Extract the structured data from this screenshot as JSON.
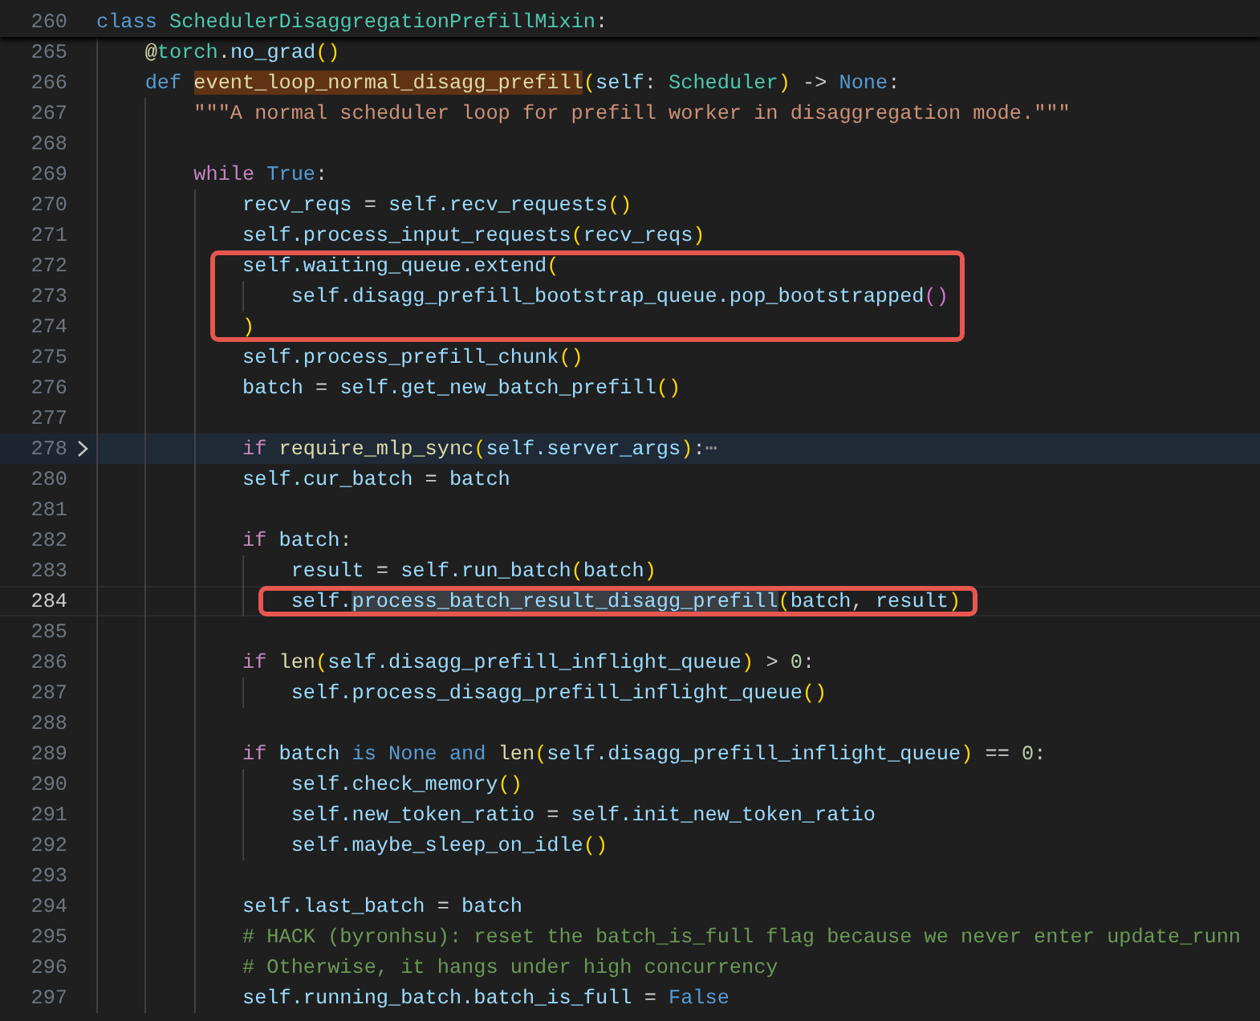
{
  "sticky_line": {
    "number": "260",
    "tokens": [
      {
        "kind": "kw",
        "text": "class "
      },
      {
        "kind": "type",
        "text": "SchedulerDisaggregationPrefillMixin"
      },
      {
        "kind": "op",
        "text": ":"
      }
    ]
  },
  "lines": [
    {
      "number": "265",
      "current": false,
      "folded": false,
      "boxed": false,
      "tokens": [
        {
          "kind": "deco",
          "text": "@"
        },
        {
          "kind": "type",
          "text": "torch"
        },
        {
          "kind": "op",
          "text": "."
        },
        {
          "kind": "var",
          "text": "no_grad"
        },
        {
          "kind": "paren",
          "text": "()"
        }
      ]
    },
    {
      "number": "266",
      "current": false,
      "folded": false,
      "boxed": false,
      "tokens": [
        {
          "kind": "kw",
          "text": "def "
        },
        {
          "kind": "fn",
          "text": "event_loop_normal_disagg_prefill",
          "highlighted": true
        },
        {
          "kind": "paren",
          "text": "("
        },
        {
          "kind": "var",
          "text": "self"
        },
        {
          "kind": "op",
          "text": ": "
        },
        {
          "kind": "type",
          "text": "Scheduler"
        },
        {
          "kind": "paren",
          "text": ")"
        },
        {
          "kind": "op",
          "text": " -> "
        },
        {
          "kind": "kw",
          "text": "None"
        },
        {
          "kind": "op",
          "text": ":"
        }
      ],
      "children": [
        {
          "number": "267",
          "current": false,
          "folded": false,
          "boxed": false,
          "tokens": [
            {
              "kind": "str",
              "text": "\"\"\"A normal scheduler loop for prefill worker in disaggregation mode.\"\"\""
            }
          ]
        },
        {
          "number": "268",
          "current": false,
          "folded": false,
          "boxed": false
        },
        {
          "number": "269",
          "current": false,
          "folded": false,
          "boxed": false,
          "tokens": [
            {
              "kind": "ctrl",
              "text": "while "
            },
            {
              "kind": "kw",
              "text": "True"
            },
            {
              "kind": "op",
              "text": ":"
            }
          ],
          "children": [
            {
              "number": "270",
              "current": false,
              "folded": false,
              "boxed": false,
              "tokens": [
                {
                  "kind": "var",
                  "text": "recv_reqs"
                },
                {
                  "kind": "op",
                  "text": " = "
                },
                {
                  "kind": "var",
                  "text": "self.recv_requests"
                },
                {
                  "kind": "paren",
                  "text": "()"
                }
              ]
            },
            {
              "number": "271",
              "current": false,
              "folded": false,
              "boxed": false,
              "tokens": [
                {
                  "kind": "var",
                  "text": "self.process_input_requests"
                },
                {
                  "kind": "paren",
                  "text": "("
                },
                {
                  "kind": "var",
                  "text": "recv_reqs"
                },
                {
                  "kind": "paren",
                  "text": ")"
                }
              ]
            },
            {
              "number": "272",
              "current": false,
              "folded": false,
              "boxed": true,
              "tokens": [
                {
                  "kind": "var",
                  "text": "self.waiting_queue.extend"
                },
                {
                  "kind": "paren",
                  "text": "("
                }
              ],
              "children": [
                {
                  "number": "273",
                  "current": false,
                  "folded": false,
                  "boxed": true,
                  "tokens": [
                    {
                      "kind": "var",
                      "text": "self.disagg_prefill_bootstrap_queue.pop_bootstrapped"
                    },
                    {
                      "kind": "paren2",
                      "text": "()"
                    }
                  ]
                }
              ]
            },
            {
              "number": "274",
              "current": false,
              "folded": false,
              "boxed": true,
              "tokens": [
                {
                  "kind": "paren",
                  "text": ")"
                }
              ]
            },
            {
              "number": "275",
              "current": false,
              "folded": false,
              "boxed": false,
              "tokens": [
                {
                  "kind": "var",
                  "text": "self.process_prefill_chunk"
                },
                {
                  "kind": "paren",
                  "text": "()"
                }
              ]
            },
            {
              "number": "276",
              "current": false,
              "folded": false,
              "boxed": false,
              "tokens": [
                {
                  "kind": "var",
                  "text": "batch"
                },
                {
                  "kind": "op",
                  "text": " = "
                },
                {
                  "kind": "var",
                  "text": "self.get_new_batch_prefill"
                },
                {
                  "kind": "paren",
                  "text": "()"
                }
              ]
            },
            {
              "number": "277",
              "current": false,
              "folded": false,
              "boxed": false
            },
            {
              "number": "278",
              "current": false,
              "folded": true,
              "boxed": false,
              "tokens": [
                {
                  "kind": "ctrl",
                  "text": "if "
                },
                {
                  "kind": "fn",
                  "text": "require_mlp_sync"
                },
                {
                  "kind": "paren",
                  "text": "("
                },
                {
                  "kind": "var",
                  "text": "self.server_args"
                },
                {
                  "kind": "paren",
                  "text": ")"
                },
                {
                  "kind": "op",
                  "text": ":"
                },
                {
                  "kind": "fold",
                  "text": "⋯"
                }
              ]
            },
            {
              "number": "280",
              "current": false,
              "folded": false,
              "boxed": false,
              "tokens": [
                {
                  "kind": "var",
                  "text": "self.cur_batch"
                },
                {
                  "kind": "op",
                  "text": " = "
                },
                {
                  "kind": "var",
                  "text": "batch"
                }
              ]
            },
            {
              "number": "281",
              "current": false,
              "folded": false,
              "boxed": false
            },
            {
              "number": "282",
              "current": false,
              "folded": false,
              "boxed": false,
              "tokens": [
                {
                  "kind": "ctrl",
                  "text": "if "
                },
                {
                  "kind": "var",
                  "text": "batch"
                },
                {
                  "kind": "op",
                  "text": ":"
                }
              ],
              "children": [
                {
                  "number": "283",
                  "current": false,
                  "folded": false,
                  "boxed": false,
                  "tokens": [
                    {
                      "kind": "var",
                      "text": "result"
                    },
                    {
                      "kind": "op",
                      "text": " = "
                    },
                    {
                      "kind": "var",
                      "text": "self.run_batch"
                    },
                    {
                      "kind": "paren",
                      "text": "("
                    },
                    {
                      "kind": "var",
                      "text": "batch"
                    },
                    {
                      "kind": "paren",
                      "text": ")"
                    }
                  ]
                },
                {
                  "number": "284",
                  "current": true,
                  "folded": false,
                  "boxed": true,
                  "tokens": [
                    {
                      "kind": "var",
                      "text": "self."
                    },
                    {
                      "kind": "var",
                      "text": "process_batch_result_disagg_prefill",
                      "highlighted": true
                    },
                    {
                      "kind": "paren",
                      "text": "("
                    },
                    {
                      "kind": "var",
                      "text": "batch"
                    },
                    {
                      "kind": "op",
                      "text": ", "
                    },
                    {
                      "kind": "var",
                      "text": "result"
                    },
                    {
                      "kind": "paren",
                      "text": ")"
                    }
                  ]
                }
              ]
            },
            {
              "number": "285",
              "current": false,
              "folded": false,
              "boxed": false
            },
            {
              "number": "286",
              "current": false,
              "folded": false,
              "boxed": false,
              "tokens": [
                {
                  "kind": "ctrl",
                  "text": "if "
                },
                {
                  "kind": "fn",
                  "text": "len"
                },
                {
                  "kind": "paren",
                  "text": "("
                },
                {
                  "kind": "var",
                  "text": "self.disagg_prefill_inflight_queue"
                },
                {
                  "kind": "paren",
                  "text": ")"
                },
                {
                  "kind": "op",
                  "text": " > "
                },
                {
                  "kind": "num",
                  "text": "0"
                },
                {
                  "kind": "op",
                  "text": ":"
                }
              ],
              "children": [
                {
                  "number": "287",
                  "current": false,
                  "folded": false,
                  "boxed": false,
                  "tokens": [
                    {
                      "kind": "var",
                      "text": "self.process_disagg_prefill_inflight_queue"
                    },
                    {
                      "kind": "paren",
                      "text": "()"
                    }
                  ]
                }
              ]
            },
            {
              "number": "288",
              "current": false,
              "folded": false,
              "boxed": false
            },
            {
              "number": "289",
              "current": false,
              "folded": false,
              "boxed": false,
              "tokens": [
                {
                  "kind": "ctrl",
                  "text": "if "
                },
                {
                  "kind": "var",
                  "text": "batch "
                },
                {
                  "kind": "kw",
                  "text": "is "
                },
                {
                  "kind": "kw",
                  "text": "None "
                },
                {
                  "kind": "kw",
                  "text": "and "
                },
                {
                  "kind": "fn",
                  "text": "len"
                },
                {
                  "kind": "paren",
                  "text": "("
                },
                {
                  "kind": "var",
                  "text": "self.disagg_prefill_inflight_queue"
                },
                {
                  "kind": "paren",
                  "text": ")"
                },
                {
                  "kind": "op",
                  "text": " == "
                },
                {
                  "kind": "num",
                  "text": "0"
                },
                {
                  "kind": "op",
                  "text": ":"
                }
              ],
              "children": [
                {
                  "number": "290",
                  "current": false,
                  "folded": false,
                  "boxed": false,
                  "tokens": [
                    {
                      "kind": "var",
                      "text": "self.check_memory"
                    },
                    {
                      "kind": "paren",
                      "text": "()"
                    }
                  ]
                },
                {
                  "number": "291",
                  "current": false,
                  "folded": false,
                  "boxed": false,
                  "tokens": [
                    {
                      "kind": "var",
                      "text": "self.new_token_ratio"
                    },
                    {
                      "kind": "op",
                      "text": " = "
                    },
                    {
                      "kind": "var",
                      "text": "self.init_new_token_ratio"
                    }
                  ]
                },
                {
                  "number": "292",
                  "current": false,
                  "folded": false,
                  "boxed": false,
                  "tokens": [
                    {
                      "kind": "var",
                      "text": "self.maybe_sleep_on_idle"
                    },
                    {
                      "kind": "paren",
                      "text": "()"
                    }
                  ]
                }
              ]
            },
            {
              "number": "293",
              "current": false,
              "folded": false,
              "boxed": false
            },
            {
              "number": "294",
              "current": false,
              "folded": false,
              "boxed": false,
              "tokens": [
                {
                  "kind": "var",
                  "text": "self.last_batch"
                },
                {
                  "kind": "op",
                  "text": " = "
                },
                {
                  "kind": "var",
                  "text": "batch"
                }
              ]
            },
            {
              "number": "295",
              "current": false,
              "folded": false,
              "boxed": false,
              "tokens": [
                {
                  "kind": "cmt",
                  "text": "# HACK (byronhsu): reset the batch_is_full flag because we never enter update_runn"
                }
              ]
            },
            {
              "number": "296",
              "current": false,
              "folded": false,
              "boxed": false,
              "tokens": [
                {
                  "kind": "cmt",
                  "text": "# Otherwise, it hangs under high concurrency"
                }
              ]
            },
            {
              "number": "297",
              "current": false,
              "folded": false,
              "boxed": false,
              "tokens": [
                {
                  "kind": "var",
                  "text": "self.running_batch.batch_is_full"
                },
                {
                  "kind": "op",
                  "text": " = "
                },
                {
                  "kind": "kw",
                  "text": "False"
                }
              ]
            }
          ]
        }
      ]
    }
  ]
}
